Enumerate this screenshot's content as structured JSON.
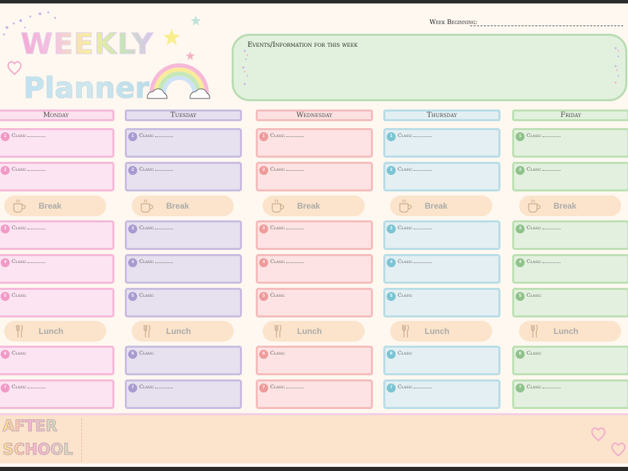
{
  "title": {
    "line1": "WEEKLY",
    "line2": "Planner"
  },
  "week_beginning_label": "Week Beginning:",
  "events_label": "Events/Information for this week",
  "class_label": "Class:",
  "days": [
    {
      "name": "Monday",
      "header_bg": "#fce1ef",
      "border": "#f5b9d8",
      "slot_bg": "#fde4f2",
      "num_color": "#f29ac7"
    },
    {
      "name": "Tuesday",
      "header_bg": "#e6dff0",
      "border": "#c8bde0",
      "slot_bg": "#e6e0ef",
      "num_color": "#a89bd1"
    },
    {
      "name": "Wednesday",
      "header_bg": "#fde1e1",
      "border": "#f5bcbc",
      "slot_bg": "#fde3e3",
      "num_color": "#ee9b9b"
    },
    {
      "name": "Thursday",
      "header_bg": "#e2eff3",
      "border": "#b9dde6",
      "slot_bg": "#e3eff3",
      "num_color": "#7cc4d2"
    },
    {
      "name": "Friday",
      "header_bg": "#e2f1de",
      "border": "#bde0b4",
      "slot_bg": "#e3f0df",
      "num_color": "#8fc28b"
    }
  ],
  "periods": [
    "1",
    "2",
    "3",
    "4",
    "5",
    "6",
    "7"
  ],
  "break_label": "Break",
  "lunch_label": "Lunch",
  "after_school": {
    "line1": "AFTER",
    "line2": "SCHOOL"
  }
}
